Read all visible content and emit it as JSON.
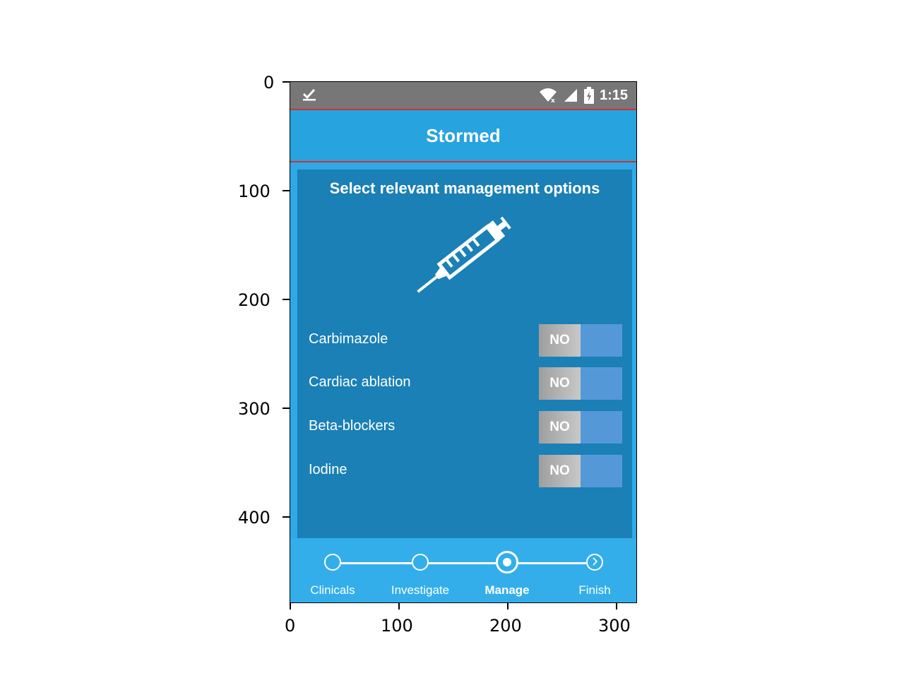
{
  "axes": {
    "y_ticks": [
      "0",
      "100",
      "200",
      "300",
      "400"
    ],
    "x_ticks": [
      "0",
      "100",
      "200",
      "300"
    ]
  },
  "status_bar": {
    "left_icon": "checkmark-download-icon",
    "time": "1:15"
  },
  "header": {
    "title": "Stormed"
  },
  "card": {
    "title": "Select relevant management options",
    "illustration": "syringe-icon",
    "options": [
      {
        "label": "Carbimazole",
        "toggle_text": "NO"
      },
      {
        "label": "Cardiac ablation",
        "toggle_text": "NO"
      },
      {
        "label": "Beta-blockers",
        "toggle_text": "NO"
      },
      {
        "label": "Iodine",
        "toggle_text": "NO"
      }
    ]
  },
  "stepper": {
    "steps": [
      {
        "label": "Clinicals"
      },
      {
        "label": "Investigate"
      },
      {
        "label": "Manage"
      },
      {
        "label": "Finish"
      }
    ],
    "active_step": "Manage"
  },
  "colors": {
    "status_bar": "#777777",
    "header": "#27a3df",
    "card": "#1a80b6",
    "background": "#2fa8e6",
    "toggle_yes": "#5598d8"
  }
}
